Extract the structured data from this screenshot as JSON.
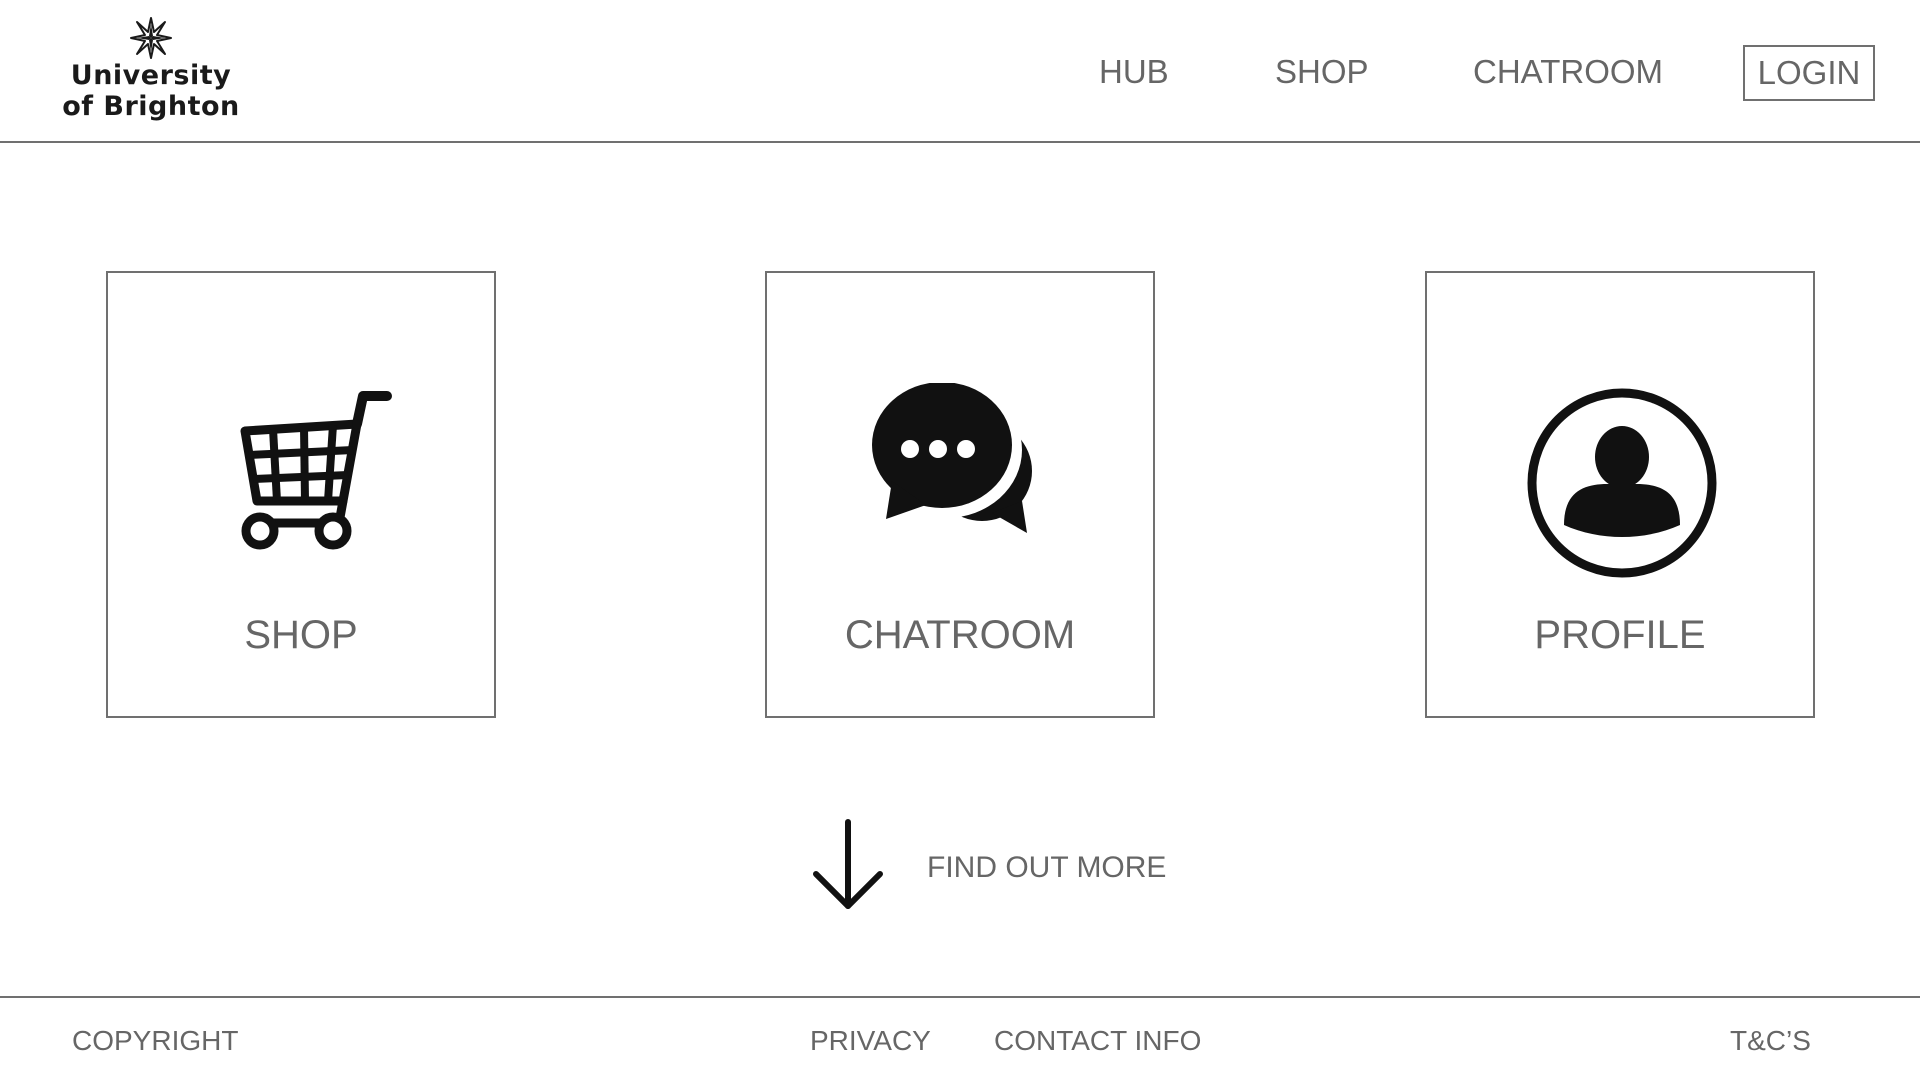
{
  "header": {
    "logo": {
      "line1": "University",
      "line2": "of Brighton",
      "icon": "star-icon"
    },
    "nav": {
      "hub": "HUB",
      "shop": "SHOP",
      "chatroom": "CHATROOM",
      "login": "LOGIN"
    }
  },
  "cards": [
    {
      "label": "SHOP",
      "icon": "shopping-cart-icon"
    },
    {
      "label": "CHATROOM",
      "icon": "chat-bubbles-icon"
    },
    {
      "label": "PROFILE",
      "icon": "user-profile-icon"
    }
  ],
  "find_more": {
    "label": "FIND OUT MORE",
    "icon": "arrow-down-icon"
  },
  "footer": {
    "copyright": "COPYRIGHT",
    "privacy": "PRIVACY",
    "contact": "CONTACT INFO",
    "tcs": "T&C’S"
  },
  "colors": {
    "text": "#666666",
    "border": "#707070",
    "icon": "#111111",
    "background": "#ffffff"
  }
}
